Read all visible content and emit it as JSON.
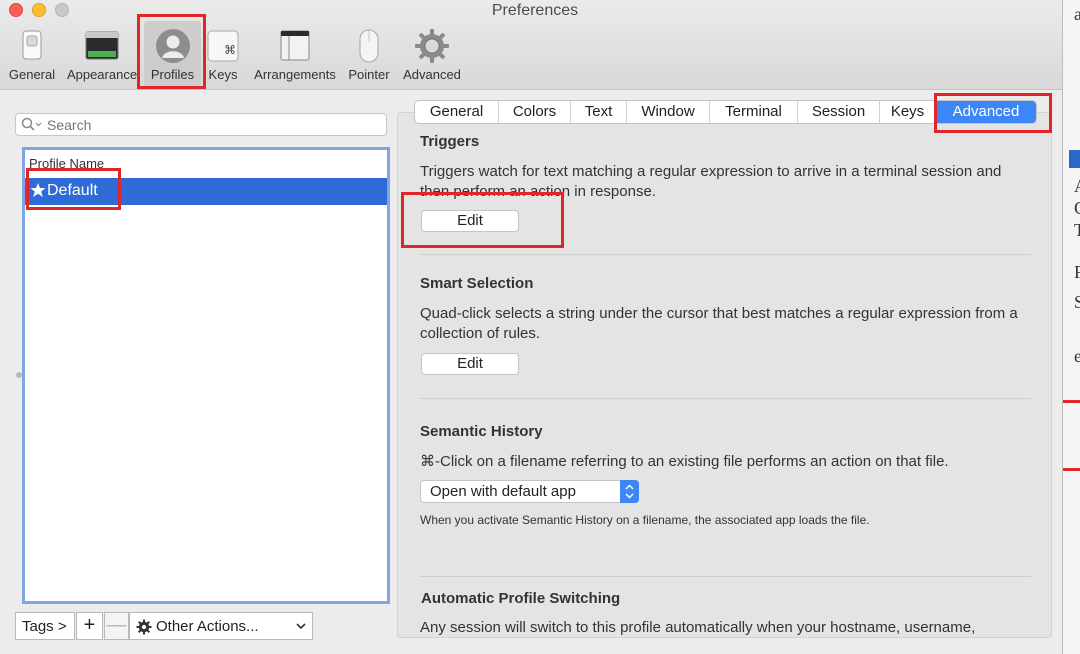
{
  "window": {
    "title": "Preferences"
  },
  "toolbar": {
    "items": [
      {
        "label": "General",
        "icon": "switch-icon"
      },
      {
        "label": "Appearance",
        "icon": "window-appearance-icon"
      },
      {
        "label": "Profiles",
        "icon": "profile-avatar-icon",
        "selected": true
      },
      {
        "label": "Keys",
        "icon": "command-key-icon"
      },
      {
        "label": "Arrangements",
        "icon": "window-arrangement-icon"
      },
      {
        "label": "Pointer",
        "icon": "mouse-icon"
      },
      {
        "label": "Advanced",
        "icon": "gear-icon"
      }
    ]
  },
  "sidebar": {
    "search_placeholder": "Search",
    "list_header": "Profile Name",
    "profiles": [
      {
        "label": "Default",
        "is_default": true,
        "selected": true
      }
    ],
    "tags_label": "Tags >",
    "add_label": "+",
    "remove_label": "—",
    "other_actions_label": "Other Actions..."
  },
  "tabs": [
    {
      "label": "General"
    },
    {
      "label": "Colors"
    },
    {
      "label": "Text"
    },
    {
      "label": "Window"
    },
    {
      "label": "Terminal"
    },
    {
      "label": "Session"
    },
    {
      "label": "Keys"
    },
    {
      "label": "Advanced",
      "active": true
    }
  ],
  "triggers": {
    "title": "Triggers",
    "description": "Triggers watch for text matching a regular expression to arrive in a terminal session and then perform an action in response.",
    "button": "Edit"
  },
  "smart_selection": {
    "title": "Smart Selection",
    "description": "Quad-click selects a string under the cursor that best matches a regular expression from a collection of rules.",
    "button": "Edit"
  },
  "semantic_history": {
    "title": "Semantic History",
    "description": "⌘-Click on a filename referring to an existing file performs an action on that file.",
    "select_value": "Open with default app",
    "note": "When you activate Semantic History on a filename, the associated app loads the file."
  },
  "auto_switching": {
    "title": "Automatic Profile Switching",
    "description": "Any session will switch to this profile automatically when your hostname, username,"
  },
  "colors": {
    "accent": "#3c86f5",
    "selection": "#2f6bd7",
    "annotation": "#e0262a"
  }
}
